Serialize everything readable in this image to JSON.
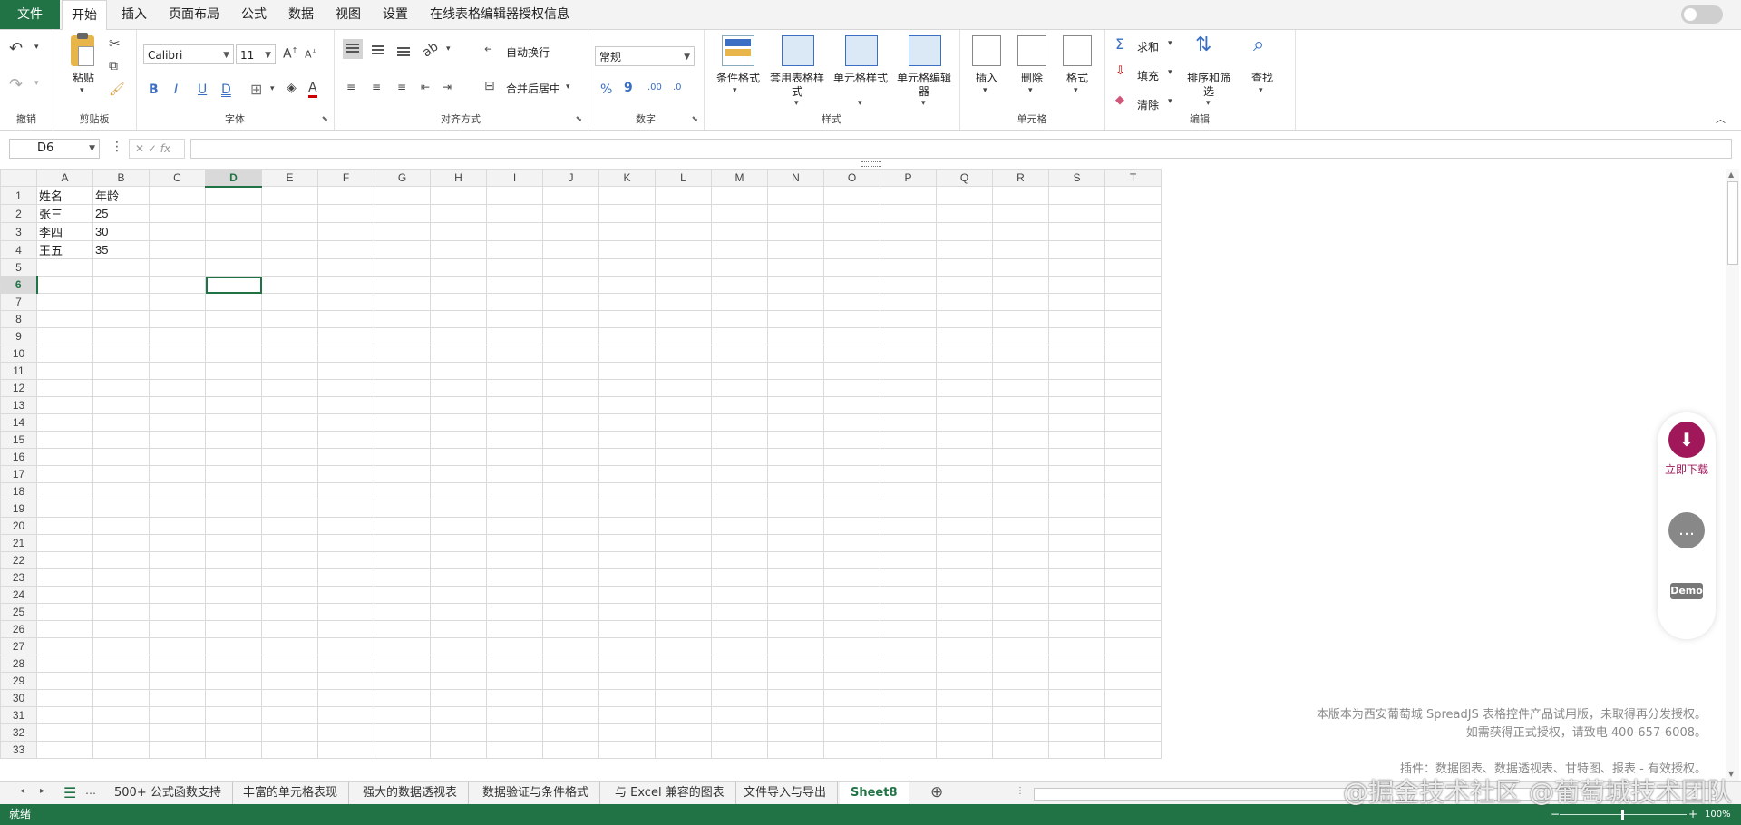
{
  "tabs": {
    "file": "文件",
    "items": [
      "开始",
      "插入",
      "页面布局",
      "公式",
      "数据",
      "视图",
      "设置",
      "在线表格编辑器授权信息"
    ],
    "active_index": 0
  },
  "ribbon": {
    "undo_group": "撤销",
    "clipboard": {
      "paste": "粘贴",
      "group": "剪贴板"
    },
    "font": {
      "name": "Calibri",
      "size": "11",
      "group": "字体",
      "bold": "B",
      "italic": "I",
      "underline": "U",
      "double_underline": "D",
      "font_color": "A"
    },
    "alignment": {
      "wrap": "自动换行",
      "merge": "合并后居中",
      "group": "对齐方式"
    },
    "number": {
      "format": "常规",
      "percent": "%",
      "comma": "9",
      "group": "数字"
    },
    "styles": {
      "conditional": "条件格式",
      "table_style": "套用表格样式",
      "cell_style": "单元格样式",
      "cell_editor": "单元格编辑器",
      "group": "样式"
    },
    "cells": {
      "insert": "插入",
      "delete": "删除",
      "format": "格式",
      "group": "单元格"
    },
    "editing": {
      "sum": "求和",
      "fill": "填充",
      "clear": "清除",
      "sort": "排序和筛选",
      "find": "查找",
      "group": "编辑"
    },
    "colors": {
      "accent": "#217346"
    }
  },
  "formula_bar": {
    "name_box": "D6",
    "fx": "fx",
    "value": ""
  },
  "sheet": {
    "columns": [
      "A",
      "B",
      "C",
      "D",
      "E",
      "F",
      "G",
      "H",
      "I",
      "J",
      "K",
      "L",
      "M",
      "N",
      "O",
      "P",
      "Q",
      "R",
      "S",
      "T"
    ],
    "selected_col": "D",
    "selected_row": 6,
    "row_count": 33,
    "cells": [
      [
        "姓名",
        "年龄"
      ],
      [
        "张三",
        "25"
      ],
      [
        "李四",
        "30"
      ],
      [
        "王五",
        "35"
      ]
    ]
  },
  "float_panel": {
    "download": "立即下载",
    "demo": "Demo"
  },
  "notice": {
    "line1": "本版本为西安葡萄城 SpreadJS 表格控件产品试用版，未取得再分发授权。",
    "line2": "如需获得正式授权，请致电 400-657-6008。",
    "line3": "插件：数据图表、数据透视表、甘特图、报表 - 有效授权。"
  },
  "sheet_tabs": {
    "items": [
      "500+ 公式函数支持",
      "丰富的单元格表现",
      "强大的数据透视表",
      "数据验证与条件格式",
      "与 Excel 兼容的图表",
      "文件导入与导出",
      "Sheet8"
    ],
    "active": "Sheet8",
    "add": "⊕"
  },
  "status": {
    "ready": "就绪",
    "zoom": "100%"
  },
  "watermark": "@掘金技术社区 @葡萄城技术团队"
}
